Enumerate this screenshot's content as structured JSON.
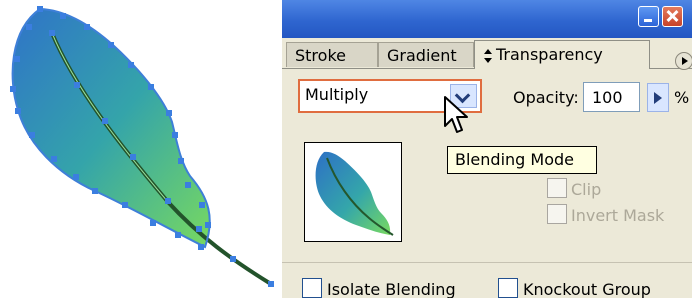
{
  "panel": {
    "tabs": [
      {
        "label": "Stroke"
      },
      {
        "label": "Gradient"
      },
      {
        "label": "Transparency",
        "active": true
      }
    ],
    "blend_mode": {
      "value": "Multiply"
    },
    "opacity": {
      "label": "Opacity:",
      "value": "100",
      "unit": "%"
    },
    "tooltip": "Blending Mode",
    "clip": {
      "label": "Clip",
      "checked": false,
      "enabled": false
    },
    "invert_mask": {
      "label": "Invert Mask",
      "checked": false,
      "enabled": false
    },
    "isolate_blending": {
      "label": "Isolate Blending",
      "checked": false
    },
    "knockout_group": {
      "label": "Knockout Group",
      "checked": false
    }
  },
  "icons": {
    "active_tab": "transparency-tab-icon",
    "menu": "panel-menu-arrow-icon",
    "dropdown": "chevron-down-icon",
    "stepper": "play-arrow-icon",
    "window_buttons": [
      "minimize-icon",
      "close-icon"
    ],
    "artwork": "feather-vector-artwork",
    "cursor": "mouse-pointer-icon"
  },
  "colors": {
    "titlebar_blue": "#2f66d0",
    "panel_gray": "#ece9d8",
    "highlight_orange": "#e06d3f",
    "tooltip_yellow": "#ffffe1",
    "feather_blue": "#2d76c6",
    "feather_green": "#66d46b"
  }
}
